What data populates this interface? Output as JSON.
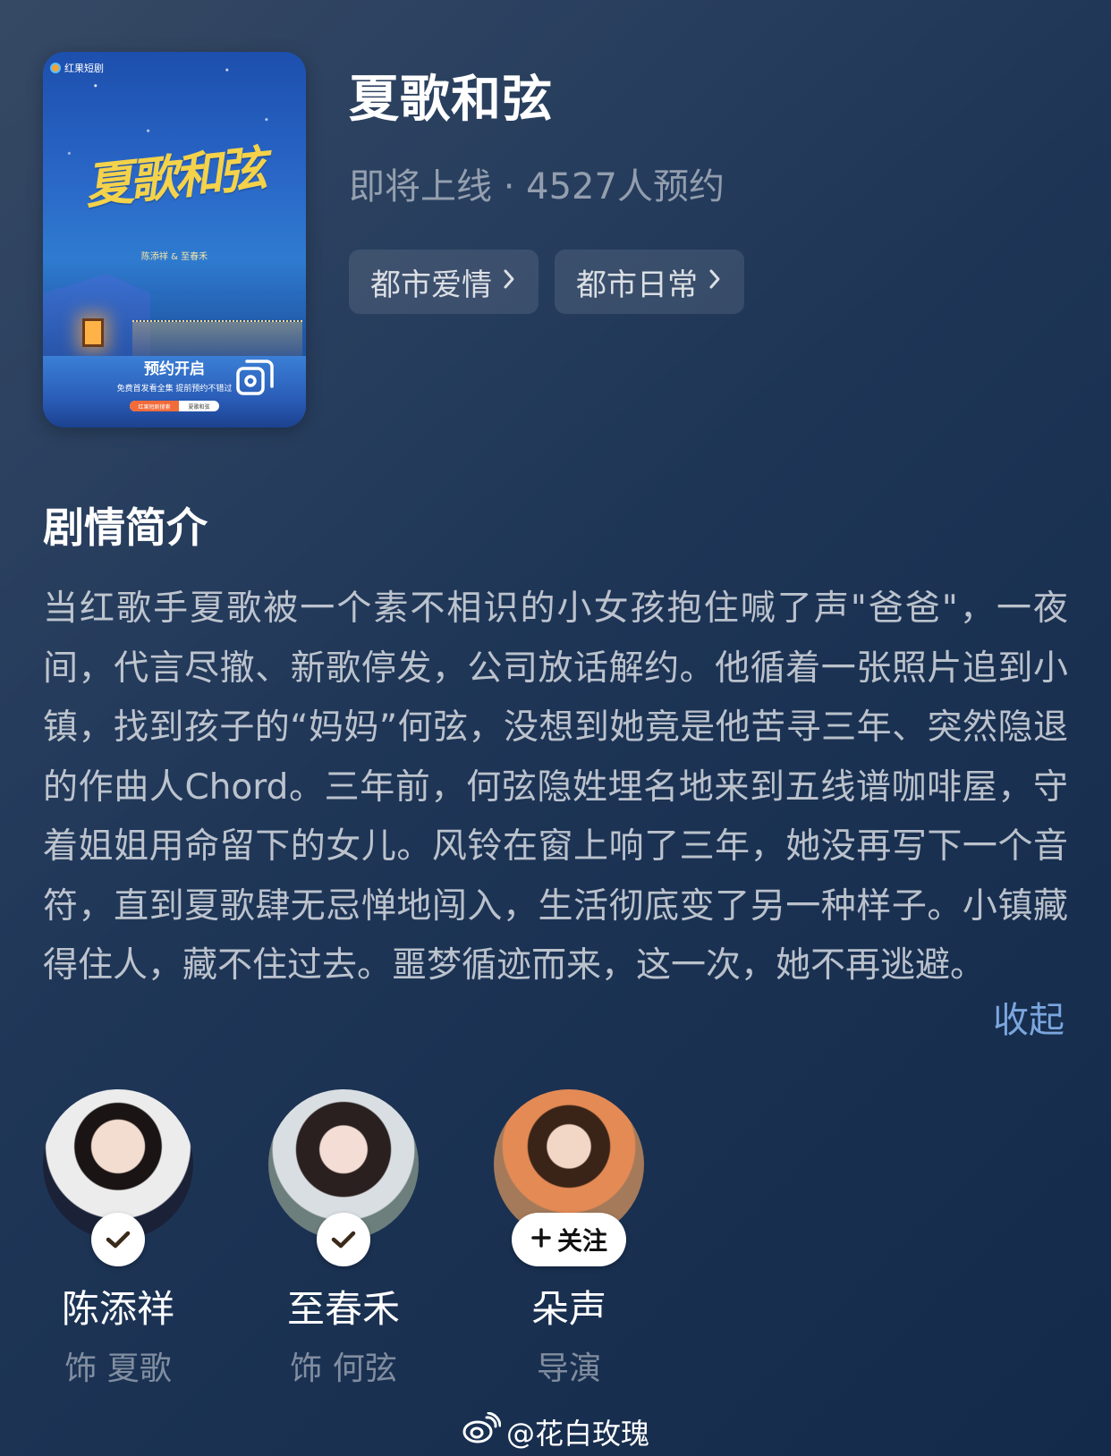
{
  "poster": {
    "brand": "红果短剧",
    "title_art": "夏歌和弦",
    "cast_line": "陈添祥 & 至春禾",
    "promo_big": "预约开启",
    "promo_small": "免费首发看全集 提前预约不错过",
    "search_left": "红果短剧搜索",
    "search_right": "夏歌和弦"
  },
  "header": {
    "title": "夏歌和弦",
    "subtitle": "即将上线 · 4527人预约"
  },
  "tags": [
    {
      "label": "都市爱情",
      "icon": "chevron-right-icon"
    },
    {
      "label": "都市日常",
      "icon": "chevron-right-icon"
    }
  ],
  "synopsis": {
    "heading": "剧情简介",
    "text": "当红歌手夏歌被一个素不相识的小女孩抱住喊了声\"爸爸\"，一夜间，代言尽撤、新歌停发，公司放话解约。他循着一张照片追到小镇，找到孩子的“妈妈”何弦，没想到她竟是他苦寻三年、突然隐退的作曲人Chord。三年前，何弦隐姓埋名地来到五线谱咖啡屋，守着姐姐用命留下的女儿。风铃在窗上响了三年，她没再写下一个音符，直到夏歌肆无忌惮地闯入，生活彻底变了另一种样子。小镇藏得住人，藏不住过去。噩梦循迹而来，这一次，她不再逃避。",
    "collapse_label": "收起"
  },
  "cast": [
    {
      "name": "陈添祥",
      "role": "饰 夏歌",
      "status": "following"
    },
    {
      "name": "至春禾",
      "role": "饰 何弦",
      "status": "following"
    },
    {
      "name": "朵声",
      "role": "导演",
      "status": "follow",
      "follow_label": "关注"
    }
  ],
  "watermark": {
    "text": "@花白玫瑰",
    "icon": "weibo-icon"
  },
  "colors": {
    "background_top": "#2b3f5c",
    "background_bottom": "#142a4a",
    "link": "#7aa6de",
    "title_art": "#f4d24a"
  }
}
